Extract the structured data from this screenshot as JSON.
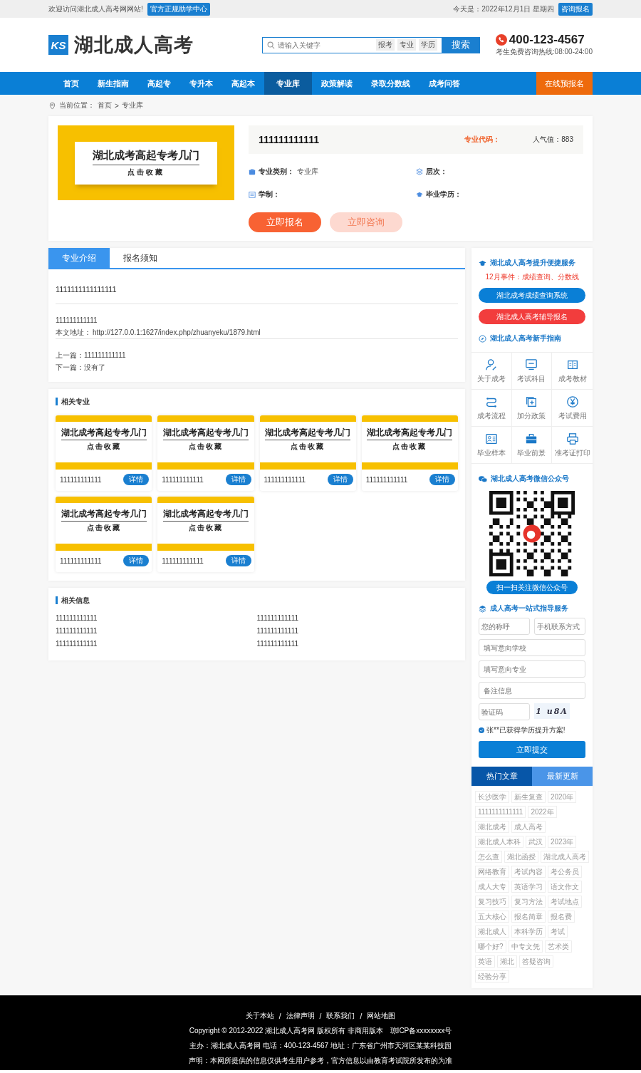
{
  "top_bar": {
    "welcome": "欢迎访问湖北成人高考网网站!",
    "badge": "官方正规助学中心",
    "date": "今天是：2022年12月1日 星期四",
    "consult_button": "咨询报名"
  },
  "header": {
    "logo_mark": "KS",
    "logo_text": "湖北成人高考",
    "search": {
      "placeholder": "请输入关键字",
      "tags": [
        "报考",
        "专业",
        "学历"
      ],
      "button": "搜索"
    },
    "phone": "400-123-4567",
    "hotline": "考生免费咨询热线:08:00-24:00"
  },
  "nav": {
    "items": [
      {
        "label": "首页",
        "selected": false
      },
      {
        "label": "新生指南",
        "selected": false
      },
      {
        "label": "高起专",
        "selected": false
      },
      {
        "label": "专升本",
        "selected": false
      },
      {
        "label": "高起本",
        "selected": false
      },
      {
        "label": "专业库",
        "selected": true
      },
      {
        "label": "政策解读",
        "selected": false
      },
      {
        "label": "录取分数线",
        "selected": false
      },
      {
        "label": "成考问答",
        "selected": false
      }
    ],
    "cta": "在线预报名"
  },
  "breadcrumb": {
    "label": "当前位置：",
    "items": [
      "首页",
      "专业库"
    ],
    "separator": ">"
  },
  "major": {
    "banner": {
      "title": "湖北成考高起专考几门",
      "subtitle": "点击收藏"
    },
    "name": "111111111111",
    "code_label": "专业代码：",
    "popularity": "人气值：883",
    "fields": [
      {
        "label": "专业类别：",
        "value": "专业库"
      },
      {
        "label": "层次："
      },
      {
        "label": "学制："
      },
      {
        "label": "毕业学历："
      }
    ],
    "buttons": [
      {
        "label": "立即报名",
        "kind": "primary"
      },
      {
        "label": "立即咨询",
        "kind": "secondary"
      }
    ]
  },
  "tabs": [
    {
      "label": "专业介绍",
      "selected": true
    },
    {
      "label": "报名须知",
      "selected": false
    }
  ],
  "article": {
    "lead": "1111111111111111",
    "body": "111111111111",
    "address_label": "本文地址：",
    "address": "http://127.0.0.1:1627/index.php/zhuanyeku/1879.html",
    "prev": "上一篇：111111111111",
    "next": "下一篇：没有了"
  },
  "related_majors": {
    "title": "相关专业",
    "items": [
      {
        "banner_title": "湖北成考高起专考几门",
        "banner_subtitle": "点击收藏",
        "name": "111111111111",
        "button": "详情"
      },
      {
        "banner_title": "湖北成考高起专考几门",
        "banner_subtitle": "点击收藏",
        "name": "111111111111",
        "button": "详情"
      },
      {
        "banner_title": "湖北成考高起专考几门",
        "banner_subtitle": "点击收藏",
        "name": "111111111111",
        "button": "详情"
      },
      {
        "banner_title": "湖北成考高起专考几门",
        "banner_subtitle": "点击收藏",
        "name": "111111111111",
        "button": "详情"
      },
      {
        "banner_title": "湖北成考高起专考几门",
        "banner_subtitle": "点击收藏",
        "name": "111111111111",
        "button": "详情"
      },
      {
        "banner_title": "湖北成考高起专考几门",
        "banner_subtitle": "点击收藏",
        "name": "111111111111",
        "button": "详情"
      }
    ]
  },
  "related_info": {
    "title": "相关信息",
    "items": [
      "111111111111",
      "111111111111",
      "111111111111",
      "111111111111",
      "111111111111",
      "111111111111"
    ]
  },
  "sidebar": {
    "service": {
      "title": "湖北成人高考提升便捷服务",
      "notice": "12月事件：成绩查询、分数线",
      "buttons": [
        {
          "label": "湖北成考成绩查询系统",
          "kind": "primary"
        },
        {
          "label": "湖北成人高考辅导报名",
          "kind": "danger"
        }
      ]
    },
    "guide": {
      "title": "湖北成人高考新手指南",
      "items": [
        "关于成考",
        "考试科目",
        "成考教材",
        "成考流程",
        "加分政策",
        "考试费用",
        "毕业样本",
        "毕业前景",
        "准考证打印"
      ]
    },
    "wechat": {
      "title": "湖北成人高考微信公众号",
      "button": "扫一扫关注微信公众号"
    },
    "form": {
      "title": "成人高考一站式指导服务",
      "fields": [
        {
          "placeholder": "您的称呼"
        },
        {
          "placeholder": "手机联系方式"
        },
        {
          "placeholder": "填写意向学校"
        },
        {
          "placeholder": "填写意向专业"
        },
        {
          "placeholder": "备注信息"
        },
        {
          "placeholder": "验证码"
        }
      ],
      "captcha": "1 u8A",
      "notice": "张**已获得学历提升方案!",
      "submit": "立即提交"
    },
    "articles": {
      "tabs": [
        {
          "label": "热门文章",
          "selected": true
        },
        {
          "label": "最新更新",
          "selected": false
        }
      ],
      "tags": [
        "长沙医学",
        "新生复查",
        "2020年",
        "1111111111111",
        "2022年",
        "湖北成考",
        "成人高考",
        "湖北成人本科",
        "武汉",
        "2023年",
        "怎么查",
        "湖北函授",
        "湖北成人高考",
        "网络教育",
        "考试内容",
        "考公务员",
        "成人大专",
        "英语学习",
        "语文作文",
        "复习技巧",
        "复习方法",
        "考试地点",
        "五大核心",
        "报名简章",
        "报名费",
        "湖北成人",
        "本科学历",
        "考试",
        "哪个好?",
        "中专文凭",
        "艺术类",
        "英语",
        "湖北",
        "答疑咨询",
        "经验分享"
      ]
    }
  },
  "footer": {
    "links": [
      "关于本站",
      "法律声明",
      "联系我们",
      "网站地图"
    ],
    "separator": "/",
    "lines": [
      "Copyright © 2012-2022 湖北成人高考网 版权所有 非商用版本　琼ICP备xxxxxxxx号",
      "主办：湖北成人高考网  电话：400-123-4567  地址：广东省广州市天河区某某科技园",
      "声明：本网所提供的信息仅供考生用户参考，官方信息以由教育考试院所发布的为准"
    ]
  }
}
